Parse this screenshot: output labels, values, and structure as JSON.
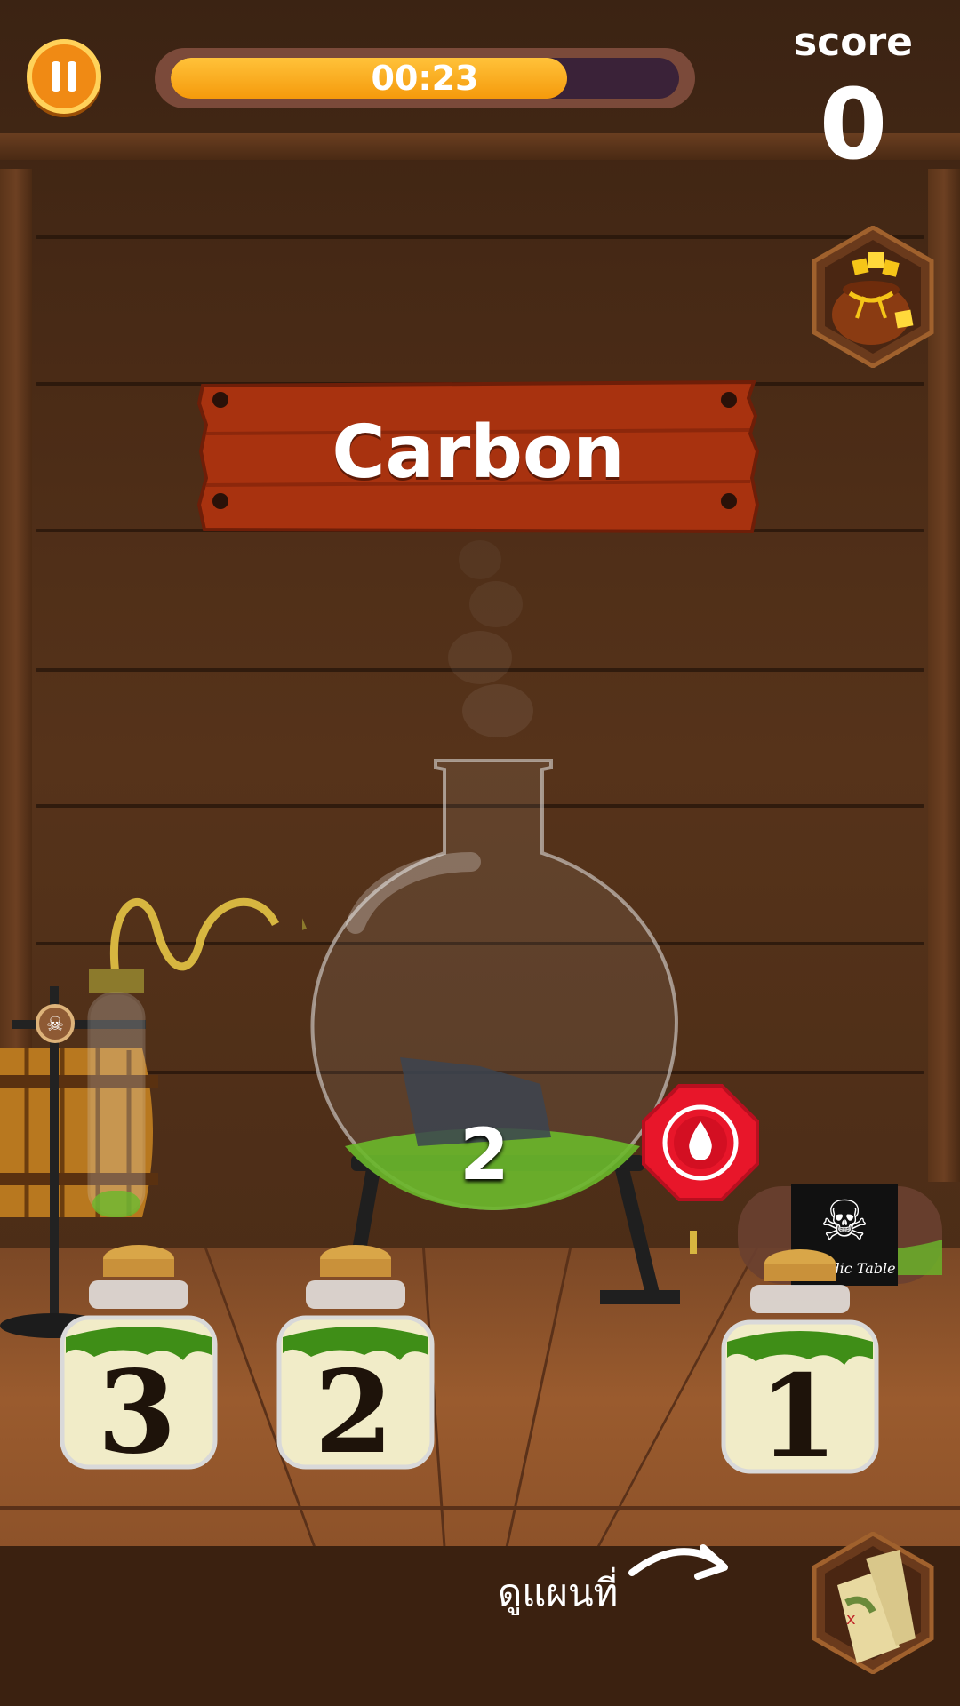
{
  "hud": {
    "timer_text": "00:23",
    "timer_fraction": 0.78,
    "score_label": "score",
    "score_value": "0"
  },
  "sign": {
    "element_name": "Carbon"
  },
  "flask": {
    "count": "2"
  },
  "jars": [
    {
      "number": "3"
    },
    {
      "number": "2"
    },
    {
      "number": "1"
    }
  ],
  "periodic_table_label": "Periodic Table",
  "map_hint": "ดูแผนที่",
  "icons": {
    "pause": "pause-icon",
    "bag": "letter-bag-icon",
    "drop": "water-drop-icon",
    "skull": "skull-crossbones-icon",
    "map": "treasure-map-icon"
  },
  "colors": {
    "accent": "#f59a0c",
    "sign": "#a8320f",
    "liquid": "#5fb021"
  }
}
